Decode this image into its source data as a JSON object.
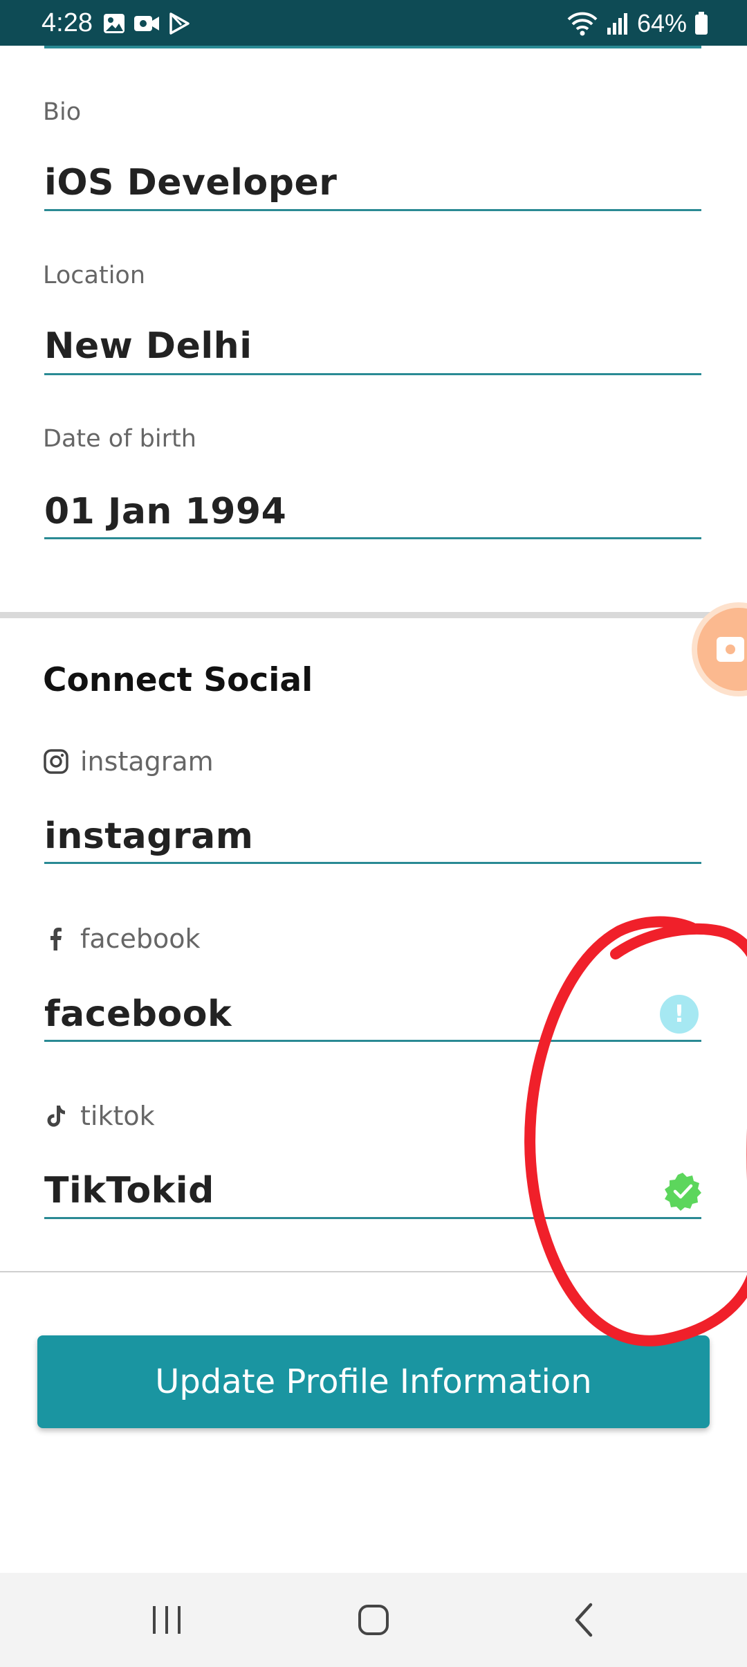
{
  "status_bar": {
    "time": "4:28",
    "battery": "64%",
    "background_color": "#0e4b55"
  },
  "profile_fields": [
    {
      "label": "Bio",
      "value": "iOS Developer"
    },
    {
      "label": "Location",
      "value": "New Delhi"
    },
    {
      "label": "Date of birth",
      "value": "01 Jan 1994"
    }
  ],
  "social": {
    "title": "Connect Social",
    "items": [
      {
        "label": "instagram",
        "icon": "instagram-icon",
        "value": "instagram",
        "status": "none"
      },
      {
        "label": "facebook",
        "icon": "facebook-icon",
        "value": "facebook",
        "status": "unverified",
        "status_icon": "exclamation-icon"
      },
      {
        "label": "tiktok",
        "icon": "tiktok-icon",
        "value": "TikTokid",
        "status": "verified",
        "status_icon": "check-badge-icon"
      }
    ]
  },
  "update_button": {
    "label": "Update Profile Information"
  },
  "colors": {
    "accent": "#1a95a1",
    "underline": "#2a8a94",
    "info_dot": "#a6e8f2",
    "verified": "#5cd65c",
    "annotation": "#f0202a"
  },
  "nav_bar": {
    "icons": [
      "recent-apps-icon",
      "home-icon",
      "back-icon"
    ]
  }
}
